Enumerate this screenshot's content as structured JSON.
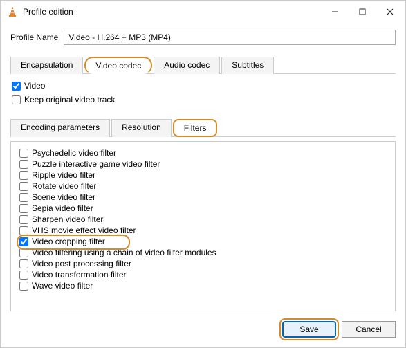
{
  "window": {
    "title": "Profile edition"
  },
  "profile": {
    "label": "Profile Name",
    "value": "Video - H.264 + MP3 (MP4)"
  },
  "mainTabs": {
    "items": [
      {
        "label": "Encapsulation",
        "active": false
      },
      {
        "label": "Video codec",
        "active": true,
        "highlight": true
      },
      {
        "label": "Audio codec",
        "active": false
      },
      {
        "label": "Subtitles",
        "active": false
      }
    ]
  },
  "options": {
    "video": {
      "label": "Video",
      "checked": true
    },
    "keepOriginal": {
      "label": "Keep original video track",
      "checked": false
    }
  },
  "subTabs": {
    "items": [
      {
        "label": "Encoding parameters",
        "active": false
      },
      {
        "label": "Resolution",
        "active": false
      },
      {
        "label": "Filters",
        "active": true,
        "highlight": true
      }
    ]
  },
  "filters": [
    {
      "label": "Psychedelic video filter",
      "checked": false
    },
    {
      "label": "Puzzle interactive game video filter",
      "checked": false
    },
    {
      "label": "Ripple video filter",
      "checked": false
    },
    {
      "label": "Rotate video filter",
      "checked": false
    },
    {
      "label": "Scene video filter",
      "checked": false
    },
    {
      "label": "Sepia video filter",
      "checked": false
    },
    {
      "label": "Sharpen video filter",
      "checked": false
    },
    {
      "label": "VHS movie effect video filter",
      "checked": false
    },
    {
      "label": "Video cropping filter",
      "checked": true,
      "highlight": true
    },
    {
      "label": "Video filtering using a chain of video filter modules",
      "checked": false
    },
    {
      "label": "Video post processing filter",
      "checked": false
    },
    {
      "label": "Video transformation filter",
      "checked": false
    },
    {
      "label": "Wave video filter",
      "checked": false
    }
  ],
  "buttons": {
    "save": "Save",
    "cancel": "Cancel"
  }
}
